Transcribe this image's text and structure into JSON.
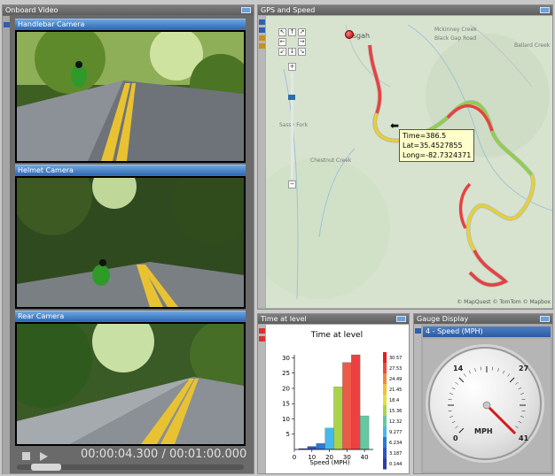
{
  "panels": {
    "onboard_video": {
      "title": "Onboard Video",
      "cameras": [
        "Handlebar Camera",
        "Helmet Camera",
        "Rear Camera"
      ],
      "timecode": "00:00:04.300 / 00:01:00.000",
      "progress": 0.07
    },
    "gps": {
      "title": "GPS and Speed",
      "place_label": "Pisgah",
      "nav": {
        "up_left": "↖",
        "up": "↑",
        "up_right": "↗",
        "left": "←",
        "right": "→",
        "down_left": "↙",
        "down": "↓",
        "down_right": "↘",
        "zoom_in": "+",
        "zoom_out": "−"
      },
      "tooltip": {
        "time": "Time=386.5",
        "lat": "Lat=35.4527855",
        "long": "Long=-82.7324371"
      },
      "attribution": "© MapQuest © TomTom © Mapbox",
      "road_labels": [
        "Mckinney Creek",
        "Black Gap Road",
        "Ballard Creek",
        "Sassy Fork",
        "Chestnut Creek"
      ]
    },
    "time_at_level": {
      "title": "Time at level"
    },
    "gauge": {
      "title": "Gauge Display",
      "selector": "4 - Speed (MPH)",
      "ticks": [
        "0",
        "14",
        "27",
        "41"
      ],
      "unit": "MPH",
      "value": 41
    }
  },
  "chart_data": {
    "type": "bar",
    "title": "Time at level",
    "xlabel": "Speed (MPH)",
    "ylabel": "",
    "xlim": [
      0,
      45
    ],
    "ylim": [
      0,
      31
    ],
    "x_ticks": [
      "0",
      "10",
      "20",
      "30",
      "40"
    ],
    "y_ticks": [
      "5",
      "10",
      "15",
      "20",
      "25",
      "30"
    ],
    "bars": [
      {
        "x": 5,
        "value": 0.3,
        "color": "#2c3da6"
      },
      {
        "x": 10,
        "value": 1,
        "color": "#2a55c4"
      },
      {
        "x": 15,
        "value": 2,
        "color": "#2a78d8"
      },
      {
        "x": 20,
        "value": 7,
        "color": "#46b8ec"
      },
      {
        "x": 25,
        "value": 20.5,
        "color": "#a9d44a"
      },
      {
        "x": 30,
        "value": 28.5,
        "color": "#ec5a48"
      },
      {
        "x": 35,
        "value": 31,
        "color": "#ee4040"
      },
      {
        "x": 40,
        "value": 11,
        "color": "#65c8a0"
      }
    ],
    "colorbar_labels": [
      "30.57",
      "27.53",
      "24.49",
      "21.45",
      "18.4",
      "15.36",
      "12.32",
      "9.277",
      "6.234",
      "3.187",
      "0.144"
    ]
  }
}
